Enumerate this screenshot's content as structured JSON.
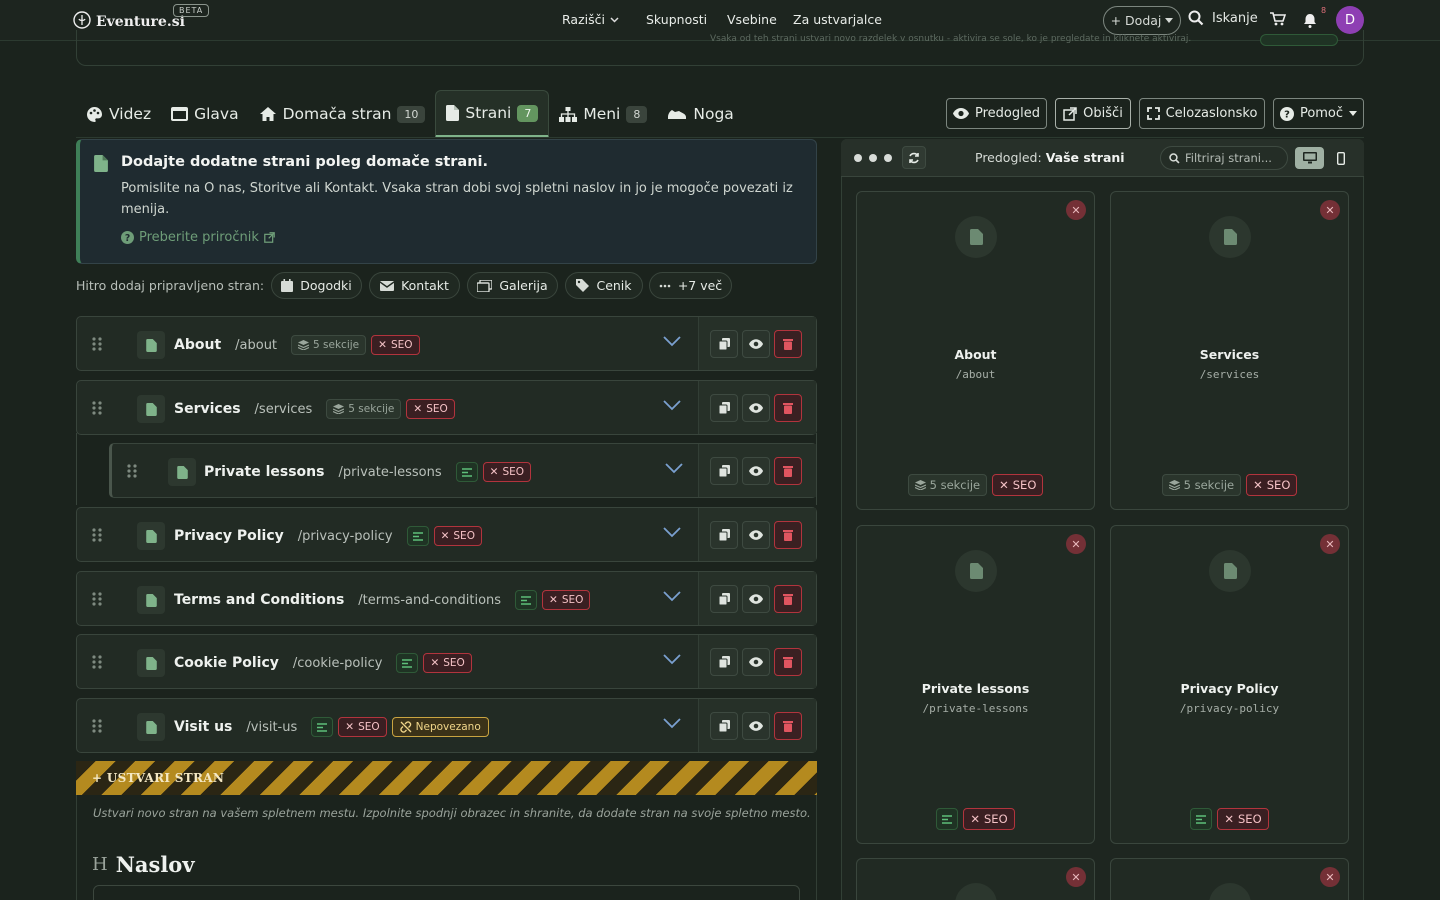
{
  "brand": {
    "name": "Eventure.si",
    "beta": "BETA"
  },
  "nav": {
    "explore": "Razišči",
    "communities": "Skupnosti",
    "content": "Vsebine",
    "creators": "Za ustvarjalce",
    "add": "+ Dodaj",
    "search": "Iskanje",
    "notif_count": "8",
    "avatar": "D"
  },
  "topcard": {
    "text": "Vsaka od teh strani ustvari novo razdelek v osnutku - aktivira se sole, ko je pregledate in kliknete aktiviraj."
  },
  "tabs": [
    {
      "label": "Videz"
    },
    {
      "label": "Glava"
    },
    {
      "label": "Domača stran",
      "count": "10"
    },
    {
      "label": "Strani",
      "count": "7",
      "active": true
    },
    {
      "label": "Meni",
      "count": "8"
    },
    {
      "label": "Noga"
    }
  ],
  "toolbar": {
    "preview": "Predogled",
    "visit": "Obišči",
    "fullscreen": "Celozaslonsko",
    "help": "Pomoč"
  },
  "info": {
    "title": "Dodajte dodatne strani poleg domače strani.",
    "text": "Pomislite na O nas, Storitve ali Kontakt. Vsaka stran dobi svoj spletni naslov in jo je mogoče povezati iz menija.",
    "link": "Preberite priročnik"
  },
  "quick_add": {
    "label": "Hitro dodaj pripravljeno stran:",
    "chips": [
      "Dogodki",
      "Kontakt",
      "Galerija",
      "Cenik",
      "+7 več"
    ]
  },
  "pages": [
    {
      "title": "About",
      "slug": "/about",
      "sections": "5 sekcije",
      "seo": "SEO"
    },
    {
      "title": "Services",
      "slug": "/services",
      "sections": "5 sekcije",
      "seo": "SEO"
    },
    {
      "title": "Private lessons",
      "slug": "/private-lessons",
      "seo": "SEO"
    },
    {
      "title": "Privacy Policy",
      "slug": "/privacy-policy",
      "seo": "SEO"
    },
    {
      "title": "Terms and Conditions",
      "slug": "/terms-and-conditions",
      "seo": "SEO"
    },
    {
      "title": "Cookie Policy",
      "slug": "/cookie-policy",
      "seo": "SEO"
    },
    {
      "title": "Visit us",
      "slug": "/visit-us",
      "seo": "SEO",
      "warning": "Nepovezano"
    }
  ],
  "create": {
    "label": "+ USTVARI STRAN",
    "description": "Ustvari novo stran na vašem spletnem mestu. Izpolnite spodnji obrazec in shranite, da dodate stran na svoje spletno mesto.",
    "field_icon": "H",
    "field_label": "Naslov"
  },
  "preview": {
    "title_prefix": "Predogled:",
    "title_bold": "Vaše strani",
    "filter_placeholder": "Filtriraj strani...",
    "cards": [
      {
        "title": "About",
        "slug": "/about",
        "sections": "5 sekcije",
        "seo": "SEO"
      },
      {
        "title": "Services",
        "slug": "/services",
        "sections": "5 sekcije",
        "seo": "SEO"
      },
      {
        "title": "Private lessons",
        "slug": "/private-lessons",
        "seo": "SEO"
      },
      {
        "title": "Privacy Policy",
        "slug": "/privacy-policy",
        "seo": "SEO"
      }
    ]
  }
}
